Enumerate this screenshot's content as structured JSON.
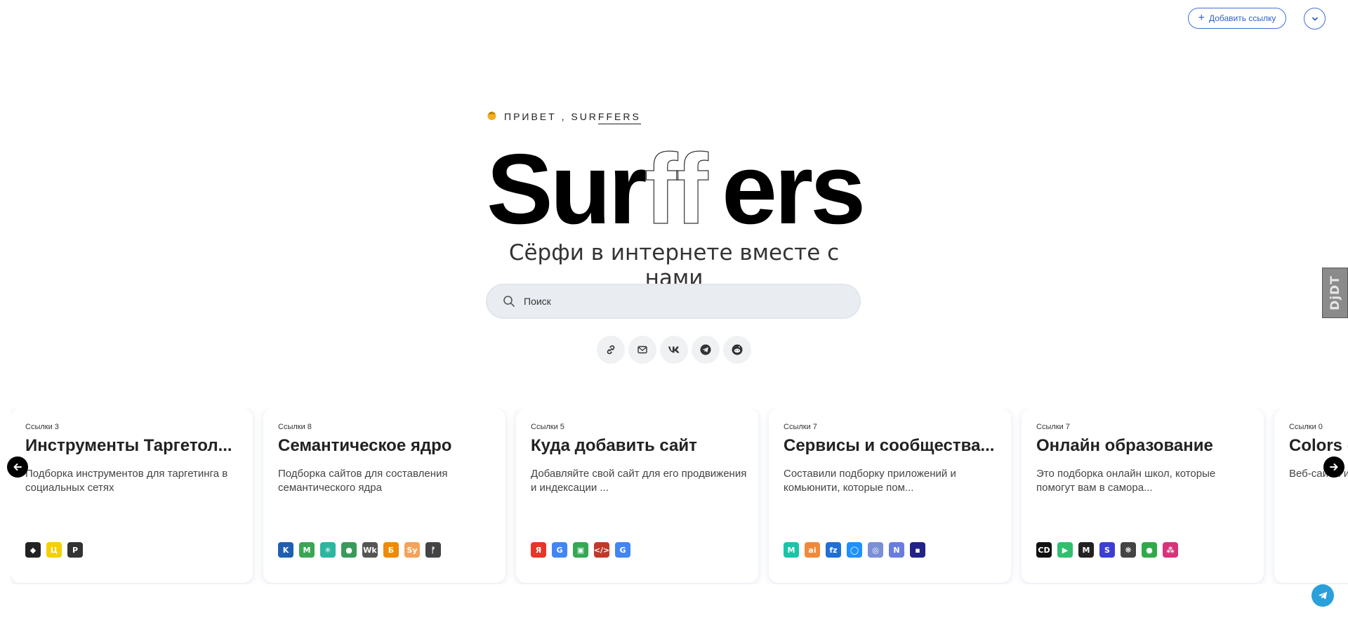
{
  "header": {
    "add_link_label": "Добавить ссылку"
  },
  "hero": {
    "greeting": "ПРИВЕТ , SUR",
    "greeting_brand": "FFERS",
    "logo_left": "Sur",
    "logo_outline": "ff",
    "logo_right": "ers",
    "tagline": "Сёрфи в интернете вместе с нами"
  },
  "search": {
    "placeholder": "Поиск"
  },
  "side_tab": {
    "label": "DjDT"
  },
  "socials": [
    "link-icon",
    "mail-icon",
    "vk-icon",
    "telegram-icon",
    "reddit-icon"
  ],
  "cards": [
    {
      "count": "Ссылки 3",
      "title": "Инструменты Таргетол...",
      "desc": "Подборка инструментов для таргетинга в социальных сетях",
      "icons": [
        {
          "t": "◆",
          "bg": "#222222"
        },
        {
          "t": "Ц",
          "bg": "#f5d000"
        },
        {
          "t": "P",
          "bg": "#333333"
        }
      ]
    },
    {
      "count": "Ссылки 8",
      "title": "Семантическое ядро",
      "desc": "Подборка сайтов для составления семантического ядра",
      "icons": [
        {
          "t": "K",
          "bg": "#1f5fb0"
        },
        {
          "t": "M",
          "bg": "#3aa655"
        },
        {
          "t": "✳",
          "bg": "#2cb6a0"
        },
        {
          "t": "●",
          "bg": "#3a9a5a"
        },
        {
          "t": "Wk",
          "bg": "#555555"
        },
        {
          "t": "Б",
          "bg": "#f08a00"
        },
        {
          "t": "Sy",
          "bg": "#f5a25a"
        },
        {
          "t": "ᚠ",
          "bg": "#444444"
        }
      ]
    },
    {
      "count": "Ссылки 5",
      "title": "Куда добавить сайт",
      "desc": "Добавляйте свой сайт для его продвижения и индексации ...",
      "icons": [
        {
          "t": "Я",
          "bg": "#e8352a"
        },
        {
          "t": "G",
          "bg": "#4285f4"
        },
        {
          "t": "▣",
          "bg": "#34a853"
        },
        {
          "t": "</>",
          "bg": "#c0392b"
        },
        {
          "t": "G",
          "bg": "#4285f4"
        }
      ]
    },
    {
      "count": "Ссылки 7",
      "title": "Сервисы и сообщества...",
      "desc": "Составили подборку приложений и комьюнити, которые пом...",
      "icons": [
        {
          "t": "M",
          "bg": "#19c4a8"
        },
        {
          "t": "ai",
          "bg": "#f08a3a"
        },
        {
          "t": "fz",
          "bg": "#1f6fd6"
        },
        {
          "t": "◯",
          "bg": "#1e90ff"
        },
        {
          "t": "◎",
          "bg": "#7b8fd6"
        },
        {
          "t": "N",
          "bg": "#6a7ce0"
        },
        {
          "t": "▪",
          "bg": "#222288"
        }
      ]
    },
    {
      "count": "Ссылки 7",
      "title": "Онлайн образование",
      "desc": "Это подборка онлайн школ, которые помогут вам в самора...",
      "icons": [
        {
          "t": "CD",
          "bg": "#111111"
        },
        {
          "t": "▶",
          "bg": "#2fbf6f"
        },
        {
          "t": "M",
          "bg": "#222222"
        },
        {
          "t": "S",
          "bg": "#3d3dd6"
        },
        {
          "t": "❋",
          "bg": "#444444"
        },
        {
          "t": "●",
          "bg": "#2faa4a"
        },
        {
          "t": "⁂",
          "bg": "#d6337a"
        }
      ]
    },
    {
      "count": "Ссылки 0",
      "title": "Colors (",
      "desc": "Веб-сайты и выбором ц",
      "icons": []
    }
  ]
}
